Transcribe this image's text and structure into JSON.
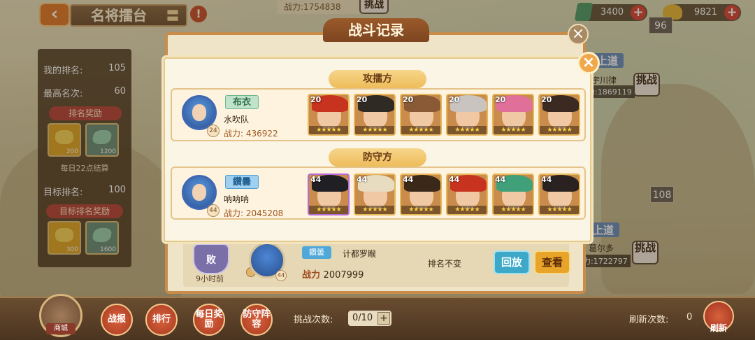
{
  "header": {
    "back_icon": "chevron-left-icon",
    "title": "名将擂台",
    "title_suffix": "〓",
    "alert_symbol": "!",
    "top_power": "战力:1754838",
    "top_challenge": "挑战"
  },
  "resources": {
    "gems": "3400",
    "gold": "9821",
    "plus": "+"
  },
  "left_panel": {
    "my_rank_label": "我的排名:",
    "my_rank": "105",
    "best_rank_label": "最高名次:",
    "best_rank": "60",
    "rank_reward_title": "排名奖励",
    "rank_rewards": [
      {
        "amount": "200"
      },
      {
        "amount": "1200"
      }
    ],
    "settle_note": "每日22点结算",
    "target_rank_label": "目标排名:",
    "target_rank": "100",
    "target_reward_title": "目标排名奖励",
    "target_rewards": [
      {
        "amount": "300"
      },
      {
        "amount": "1600"
      }
    ]
  },
  "tower": {
    "rank_96": "96",
    "rank_108": "108",
    "opponent1_banner": "上道",
    "opponent1_name": "宇川律",
    "opponent1_power": "力:1869119",
    "opponent2_banner": "上道",
    "opponent2_name": "葛尔多",
    "opponent2_power": "力:1722797",
    "challenge": "挑战"
  },
  "record": {
    "title": "战斗记录",
    "close": "×",
    "result_badge": "败",
    "time_ago": "9小时前",
    "opponent_level": "44",
    "opponent_tag": "鑽曇",
    "opponent_name": "计都罗睺",
    "power_label": "战力",
    "power_value": "2007999",
    "rank_change": "排名不变",
    "replay": "回放",
    "view": "查看"
  },
  "popup": {
    "close": "×",
    "attacker_label": "攻擂方",
    "defender_label": "防守方",
    "attacker": {
      "tag": "布衣",
      "level": "24",
      "name": "水吹队",
      "power": "战力: 436922",
      "heroes": [
        {
          "level": "20",
          "stars": "★★★★★",
          "rarity": "gold",
          "hair": "#c8331f"
        },
        {
          "level": "20",
          "stars": "★★★★★",
          "rarity": "gold",
          "hair": "#2f2a24"
        },
        {
          "level": "20",
          "stars": "★★★★★",
          "rarity": "gold",
          "hair": "#8a5a36"
        },
        {
          "level": "20",
          "stars": "★★★★★",
          "rarity": "gold",
          "hair": "#c9c4c0"
        },
        {
          "level": "20",
          "stars": "★★★★★",
          "rarity": "gold",
          "hair": "#e0709a"
        },
        {
          "level": "20",
          "stars": "★★★★★",
          "rarity": "gold",
          "hair": "#3a2a22"
        }
      ]
    },
    "defender": {
      "tag": "鑽曇",
      "level": "44",
      "name": "呐呐呐",
      "power": "战力: 2045208",
      "heroes": [
        {
          "level": "44",
          "stars": "★★★★★",
          "rarity": "purple",
          "hair": "#1f1f24"
        },
        {
          "level": "44",
          "stars": "★★★★★",
          "rarity": "gold",
          "hair": "#e8dcc0"
        },
        {
          "level": "44",
          "stars": "★★★★★",
          "rarity": "gold",
          "hair": "#3a2818"
        },
        {
          "level": "44",
          "stars": "★★★★★",
          "rarity": "gold",
          "hair": "#c8331f"
        },
        {
          "level": "44",
          "stars": "★★★★★",
          "rarity": "gold",
          "hair": "#3fa07a"
        },
        {
          "level": "44",
          "stars": "★★★★★",
          "rarity": "gold",
          "hair": "#2a2220"
        }
      ]
    }
  },
  "bottom": {
    "shop": "商城",
    "nav": [
      "战报",
      "排行",
      "每日奖励",
      "防守阵容"
    ],
    "challenge_count_label": "挑战次数:",
    "challenge_count": "0/10",
    "challenge_plus": "+",
    "refresh_count_label": "刷新次数:",
    "refresh_count": "0",
    "refresh": "刷新"
  }
}
